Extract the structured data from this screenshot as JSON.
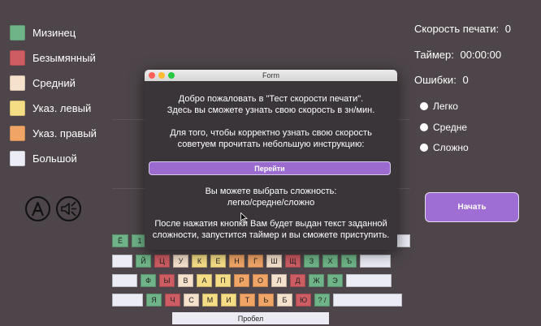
{
  "legend": [
    {
      "label": "Мизинец",
      "color": "#6fb488"
    },
    {
      "label": "Безымянный",
      "color": "#cd5c63"
    },
    {
      "label": "Средний",
      "color": "#f6e1cc"
    },
    {
      "label": "Указ. левый",
      "color": "#f5dd86"
    },
    {
      "label": "Указ. правый",
      "color": "#f0a567"
    },
    {
      "label": "Большой",
      "color": "#ececf6"
    }
  ],
  "icons": {
    "accessibility": "accessibility-icon",
    "sound": "sound-icon"
  },
  "stats": {
    "speed_label": "Скорость печати:",
    "speed_value": "0",
    "timer_label": "Таймер:",
    "timer_value": "00:00:00",
    "errors_label": "Ошибки:",
    "errors_value": "0"
  },
  "difficulty": {
    "options": [
      "Легко",
      "Средне",
      "Сложно"
    ]
  },
  "start_button": "Начать",
  "dialog": {
    "title": "Form",
    "welcome_line1": "Добро пожаловать в \"Тест скорости печати\".",
    "welcome_line2": "Здесь вы сможете узнать свою скорость в зн/мин.",
    "advice_line1": "Для того, чтобы корректно узнать свою скорость",
    "advice_line2": "советуем прочитать небольшую инструкцию:",
    "go_button": "Перейти",
    "choose_line1": "Вы можете выбрать сложность:",
    "choose_line2": "легко/средне/сложно",
    "after_line1": "После нажатия кнопки Вам будет выдан текст заданной",
    "after_line2": "сложности, запустится таймер и вы сможете приступить."
  },
  "keyboard": {
    "row1": [
      {
        "label": "Ё",
        "color": "#6fb488"
      },
      {
        "label": "1",
        "color": "#6fb488"
      }
    ],
    "row1_right": [
      {
        "label": "",
        "color": "#ececf6"
      }
    ],
    "row2": [
      {
        "label": "",
        "color": "#ececf6"
      },
      {
        "label": "Й",
        "color": "#6fb488"
      },
      {
        "label": "Ц",
        "color": "#cd5c63"
      },
      {
        "label": "У",
        "color": "#f6e1cc"
      },
      {
        "label": "К",
        "color": "#f5dd86"
      },
      {
        "label": "Е",
        "color": "#f5dd86"
      },
      {
        "label": "Н",
        "color": "#f0a567"
      },
      {
        "label": "Г",
        "color": "#f0a567"
      },
      {
        "label": "Ш",
        "color": "#f6e1cc"
      },
      {
        "label": "Щ",
        "color": "#cd5c63"
      },
      {
        "label": "З",
        "color": "#6fb488"
      },
      {
        "label": "Х",
        "color": "#6fb488"
      },
      {
        "label": "Ъ",
        "color": "#6fb488"
      },
      {
        "label": "",
        "color": "#ececf6"
      }
    ],
    "row3": [
      {
        "label": "",
        "color": "#ececf6"
      },
      {
        "label": "Ф",
        "color": "#6fb488"
      },
      {
        "label": "Ы",
        "color": "#cd5c63"
      },
      {
        "label": "В",
        "color": "#f6e1cc"
      },
      {
        "label": "А",
        "color": "#f5dd86"
      },
      {
        "label": "П",
        "color": "#f5dd86"
      },
      {
        "label": "Р",
        "color": "#f0a567"
      },
      {
        "label": "О",
        "color": "#f0a567"
      },
      {
        "label": "Л",
        "color": "#f6e1cc"
      },
      {
        "label": "Д",
        "color": "#cd5c63"
      },
      {
        "label": "Ж",
        "color": "#6fb488"
      },
      {
        "label": "Э",
        "color": "#6fb488"
      },
      {
        "label": "",
        "color": "#ececf6"
      }
    ],
    "row4": [
      {
        "label": "",
        "color": "#ececf6"
      },
      {
        "label": "Я",
        "color": "#6fb488"
      },
      {
        "label": "Ч",
        "color": "#cd5c63"
      },
      {
        "label": "С",
        "color": "#f6e1cc"
      },
      {
        "label": "М",
        "color": "#f5dd86"
      },
      {
        "label": "И",
        "color": "#f5dd86"
      },
      {
        "label": "Т",
        "color": "#f0a567"
      },
      {
        "label": "Ь",
        "color": "#f0a567"
      },
      {
        "label": "Б",
        "color": "#f6e1cc"
      },
      {
        "label": "Ю",
        "color": "#cd5c63"
      },
      {
        "label": "? /",
        "color": "#6fb488"
      },
      {
        "label": "",
        "color": "#ececf6"
      }
    ],
    "space_label": "Пробел"
  }
}
